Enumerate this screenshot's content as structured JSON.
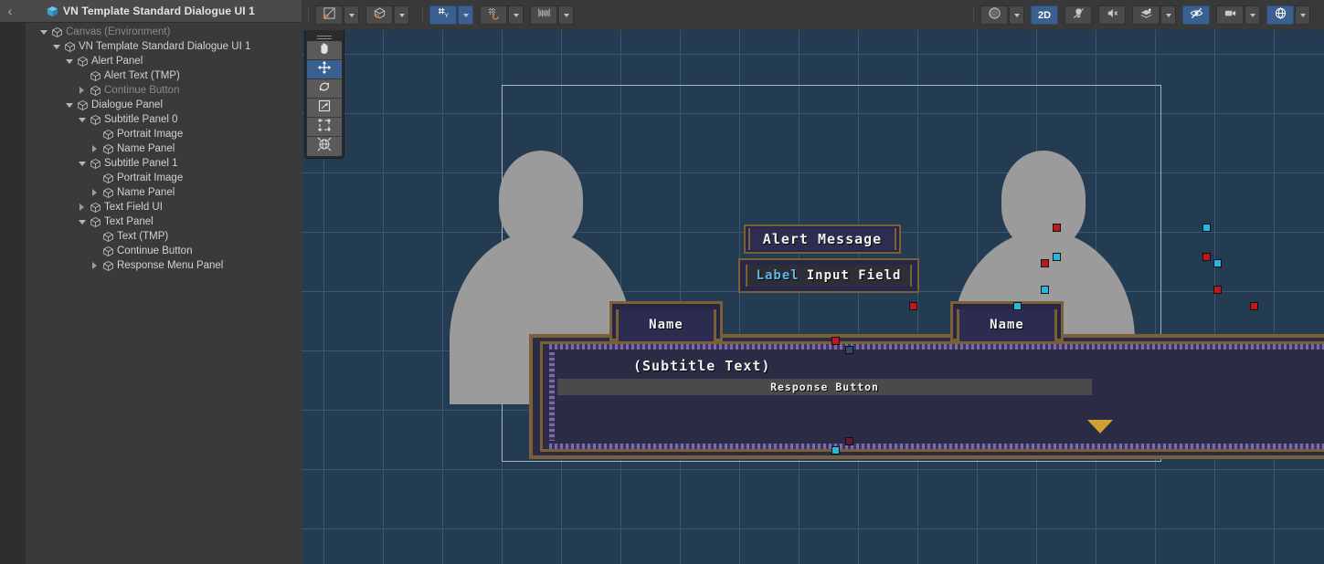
{
  "hierarchy": {
    "back_icon": "chevron-left-icon",
    "title": "VN Template Standard Dialogue UI 1",
    "title_icon": "prefab-cube-icon",
    "nodes": [
      {
        "label": "Canvas (Environment)",
        "depth": 1,
        "twisty": "open",
        "dim": true
      },
      {
        "label": "VN Template Standard Dialogue UI 1",
        "depth": 2,
        "twisty": "open",
        "dim": false
      },
      {
        "label": "Alert Panel",
        "depth": 3,
        "twisty": "open",
        "dim": false
      },
      {
        "label": "Alert Text (TMP)",
        "depth": 4,
        "twisty": "none",
        "dim": false
      },
      {
        "label": "Continue Button",
        "depth": 4,
        "twisty": "closed",
        "dim": true
      },
      {
        "label": "Dialogue Panel",
        "depth": 3,
        "twisty": "open",
        "dim": false
      },
      {
        "label": "Subtitle Panel 0",
        "depth": 4,
        "twisty": "open",
        "dim": false
      },
      {
        "label": "Portrait Image",
        "depth": 5,
        "twisty": "none",
        "dim": false
      },
      {
        "label": "Name Panel",
        "depth": 5,
        "twisty": "closed",
        "dim": false
      },
      {
        "label": "Subtitle Panel 1",
        "depth": 4,
        "twisty": "open",
        "dim": false
      },
      {
        "label": "Portrait Image",
        "depth": 5,
        "twisty": "none",
        "dim": false
      },
      {
        "label": "Name Panel",
        "depth": 5,
        "twisty": "closed",
        "dim": false
      },
      {
        "label": "Text Field UI",
        "depth": 4,
        "twisty": "closed",
        "dim": false
      },
      {
        "label": "Text Panel",
        "depth": 4,
        "twisty": "open",
        "dim": false
      },
      {
        "label": "Text (TMP)",
        "depth": 5,
        "twisty": "none",
        "dim": false
      },
      {
        "label": "Continue Button",
        "depth": 5,
        "twisty": "none",
        "dim": false
      },
      {
        "label": "Response Menu Panel",
        "depth": 5,
        "twisty": "closed",
        "dim": false
      }
    ]
  },
  "toolbar": {
    "left_tools": [
      {
        "name": "pivot-mode-toggle",
        "icon": "pivot-center-icon",
        "active": false,
        "has_dropdown": true
      },
      {
        "name": "handle-space-toggle",
        "icon": "global-local-icon",
        "active": false,
        "has_dropdown": true
      }
    ],
    "snap_tools": [
      {
        "name": "grid-visibility-toggle",
        "icon": "grid-axis-y-icon",
        "active": true,
        "has_dropdown": true
      },
      {
        "name": "grid-snapping-toggle",
        "icon": "grid-snap-magnet-icon",
        "active": false,
        "has_dropdown": true
      },
      {
        "name": "increment-snapping-toggle",
        "icon": "ruler-increment-icon",
        "active": false,
        "has_dropdown": true
      }
    ],
    "right_tools": [
      {
        "name": "draw-mode-dropdown",
        "icon": "shaded-sphere-icon",
        "label": "",
        "active": false,
        "has_dropdown": true
      },
      {
        "name": "2d-mode-toggle",
        "icon": "",
        "label": "2D",
        "active": true,
        "has_dropdown": false
      },
      {
        "name": "scene-lighting-toggle",
        "icon": "light-off-icon",
        "label": "",
        "active": false,
        "has_dropdown": false
      },
      {
        "name": "audio-toggle",
        "icon": "audio-off-icon",
        "label": "",
        "active": false,
        "has_dropdown": false
      },
      {
        "name": "fx-dropdown",
        "icon": "effects-icon",
        "label": "",
        "active": false,
        "has_dropdown": true
      },
      {
        "name": "scene-visibility-toggle",
        "icon": "hidden-eye-icon",
        "label": "",
        "active": true,
        "has_dropdown": false
      },
      {
        "name": "camera-settings",
        "icon": "camera-icon",
        "label": "",
        "active": false,
        "has_dropdown": true
      },
      {
        "name": "gizmos-toggle",
        "icon": "gizmo-globe-icon",
        "label": "",
        "active": true,
        "has_dropdown": true
      }
    ]
  },
  "tool_palette": {
    "items": [
      {
        "name": "view-tool",
        "icon": "hand-icon",
        "active": false
      },
      {
        "name": "move-tool",
        "icon": "move-arrows-icon",
        "active": true
      },
      {
        "name": "rotate-tool",
        "icon": "rotate-icon",
        "active": false
      },
      {
        "name": "scale-tool",
        "icon": "scale-icon",
        "active": false
      },
      {
        "name": "rect-tool",
        "icon": "rect-transform-icon",
        "active": false
      },
      {
        "name": "transform-tool",
        "icon": "transform-icon",
        "active": false
      }
    ]
  },
  "scene": {
    "alert_message": "Alert Message",
    "input_label": "Label",
    "input_value": "Input Field",
    "name_left": "Name",
    "name_right": "Name",
    "subtitle_text": "(Subtitle Text)",
    "response_button": "Response Button",
    "continue_arrow_icon": "triangle-down-icon",
    "portrait_left_icon": "portrait-silhouette-icon",
    "portrait_right_icon": "portrait-silhouette-icon"
  },
  "colors": {
    "scene_background": "#243c52",
    "accent_blue": "#39608f",
    "panel_gold": "#7b6036",
    "panel_fill": "#2b2b46",
    "handle_red": "#c01818",
    "handle_cyan": "#27b6dd",
    "continue_arrow": "#d2a02e",
    "label_cyan": "#5fb8e8",
    "silhouette_gray": "#9b9b9b"
  }
}
